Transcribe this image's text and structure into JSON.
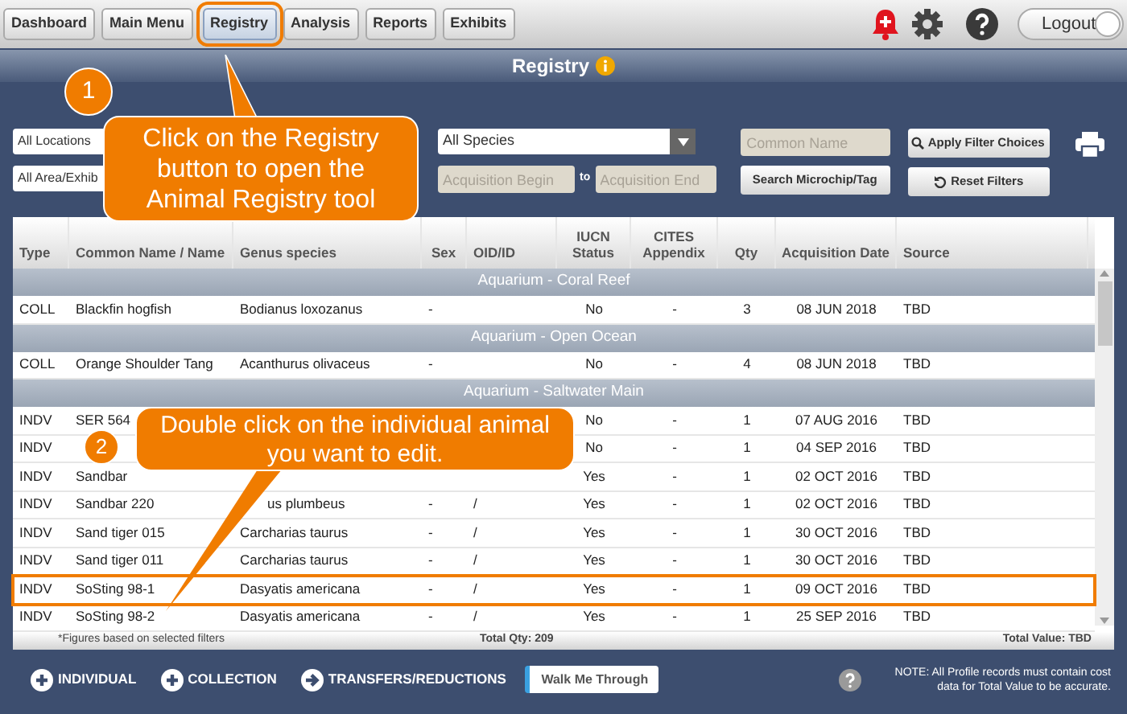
{
  "nav": [
    {
      "label": "Dashboard",
      "selected": false,
      "highlighted": false
    },
    {
      "label": "Main Menu",
      "selected": false,
      "highlighted": false
    },
    {
      "label": "Registry",
      "selected": true,
      "highlighted": true
    },
    {
      "label": "Analysis",
      "selected": false,
      "highlighted": false
    },
    {
      "label": "Reports",
      "selected": false,
      "highlighted": false
    },
    {
      "label": "Exhibits",
      "selected": false,
      "highlighted": false
    }
  ],
  "logout": {
    "label": "Logout"
  },
  "title": "Registry",
  "filters": {
    "location": "All Locations",
    "area": "All Area/Exhib",
    "species": "All Species",
    "common_name": {
      "placeholder": "Common Name"
    },
    "acquisition_begin": {
      "placeholder": "Acquisition Begin"
    },
    "to": "to",
    "acquisition_end": {
      "placeholder": "Acquisition End"
    },
    "apply": "Apply Filter Choices",
    "search_microchip": "Search Microchip/Tag",
    "reset": "Reset Filters"
  },
  "table": {
    "columns": [
      "Type",
      "Common Name / Name",
      "Genus species",
      "Sex",
      "OID/ID",
      "IUCN Status",
      "CITES Appendix",
      "Qty",
      "Acquisition Date",
      "Source"
    ],
    "rows": [
      {
        "kind": "group",
        "label": "Aquarium - Coral Reef"
      },
      {
        "kind": "record",
        "highlighted": false,
        "type": "COLL",
        "name": "Blackfin hogfish",
        "genus": "Bodianus loxozanus",
        "sex": "-",
        "iucn": "No",
        "cites": "-",
        "qty": "3",
        "date": "08 JUN 2018",
        "source": "TBD"
      },
      {
        "kind": "group",
        "label": "Aquarium - Open Ocean"
      },
      {
        "kind": "record",
        "highlighted": false,
        "type": "COLL",
        "name": "Orange Shoulder Tang",
        "genus": "Acanthurus olivaceus",
        "sex": "-",
        "iucn": "No",
        "cites": "-",
        "qty": "4",
        "date": "08 JUN 2018",
        "source": "TBD"
      },
      {
        "kind": "group",
        "label": "Aquarium - Saltwater Main"
      },
      {
        "kind": "record",
        "highlighted": false,
        "type": "INDV",
        "name": "SER 564",
        "iucn": "No",
        "cites": "-",
        "qty": "1",
        "date": "07 AUG 2016",
        "source": "TBD"
      },
      {
        "kind": "record",
        "highlighted": false,
        "type": "INDV",
        "iucn": "No",
        "cites": "-",
        "qty": "1",
        "date": "04 SEP 2016",
        "source": "TBD"
      },
      {
        "kind": "record",
        "highlighted": false,
        "type": "INDV",
        "name": "Sandbar",
        "iucn": "Yes",
        "cites": "-",
        "qty": "1",
        "date": "02 OCT 2016",
        "source": "TBD"
      },
      {
        "kind": "record",
        "highlighted": false,
        "type": "INDV",
        "name": "Sandbar 220",
        "genus": "us plumbeus",
        "sex": "-",
        "oid": "/",
        "iucn": "Yes",
        "cites": "-",
        "qty": "1",
        "date": "02 OCT 2016",
        "source": "TBD"
      },
      {
        "kind": "record",
        "highlighted": false,
        "type": "INDV",
        "name": "Sand tiger 015",
        "genus": "Carcharias taurus",
        "sex": "-",
        "oid": "/",
        "iucn": "Yes",
        "cites": "-",
        "qty": "1",
        "date": "30 OCT 2016",
        "source": "TBD"
      },
      {
        "kind": "record",
        "highlighted": false,
        "type": "INDV",
        "name": "Sand tiger 011",
        "genus": "Carcharias taurus",
        "sex": "-",
        "oid": "/",
        "iucn": "Yes",
        "cites": "-",
        "qty": "1",
        "date": "30 OCT 2016",
        "source": "TBD"
      },
      {
        "kind": "record",
        "highlighted": true,
        "type": "INDV",
        "name": "SoSting 98-1",
        "genus": "Dasyatis americana",
        "sex": "-",
        "oid": "/",
        "iucn": "Yes",
        "cites": "-",
        "qty": "1",
        "date": "09 OCT 2016",
        "source": "TBD"
      },
      {
        "kind": "record",
        "highlighted": false,
        "type": "INDV",
        "name": "SoSting 98-2",
        "genus": "Dasyatis americana",
        "sex": "-",
        "oid": "/",
        "iucn": "Yes",
        "cites": "-",
        "qty": "1",
        "date": "25 SEP 2016",
        "source": "TBD"
      }
    ],
    "note": "*Figures based on selected filters",
    "total_qty": "Total Qty: 209",
    "total_value": "Total Value: TBD"
  },
  "actions": [
    "INDIVIDUAL",
    "COLLECTION",
    "TRANSFERS/REDUCTIONS"
  ],
  "walk_me": "Walk Me Through",
  "footer_note": "NOTE: All Profile records must contain cost data for Total Value to be accurate.",
  "callouts": [
    {
      "number": "1",
      "text": "Click on the Registry button to open the Animal Registry tool"
    },
    {
      "number": "2",
      "text": "Double click on the individual animal you want to edit."
    }
  ]
}
